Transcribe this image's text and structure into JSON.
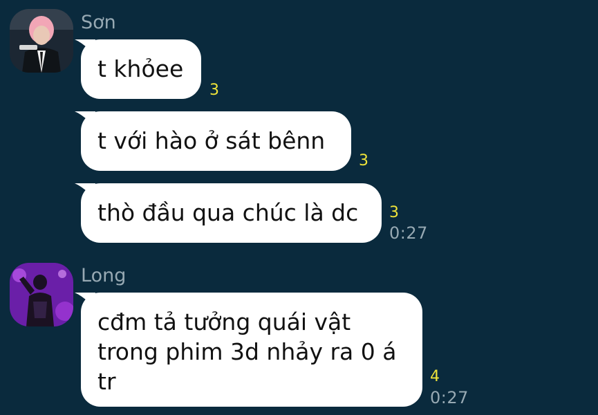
{
  "messages_group_1": {
    "sender_name": "Sơn",
    "avatar_icon": "user-photo-icon",
    "messages": [
      {
        "text": "t khỏee",
        "reaction_count": "3"
      },
      {
        "text": "t với hào ở sát bênn",
        "reaction_count": "3"
      },
      {
        "text": "thò đầu qua chúc là dc",
        "reaction_count": "3",
        "time": "0:27"
      }
    ]
  },
  "messages_group_2": {
    "sender_name": "Long",
    "avatar_icon": "user-photo-icon",
    "messages": [
      {
        "text_lines": [
          "cđm tả tưởng quái vật",
          "trong phim 3d nhảy ra 0 á",
          "tr"
        ],
        "reaction_count": "4",
        "time": "0:27"
      }
    ]
  },
  "colors": {
    "background": "#0a2a3d",
    "bubble": "#ffffff",
    "count": "#f0e43a",
    "meta_text": "#97a9b3"
  }
}
